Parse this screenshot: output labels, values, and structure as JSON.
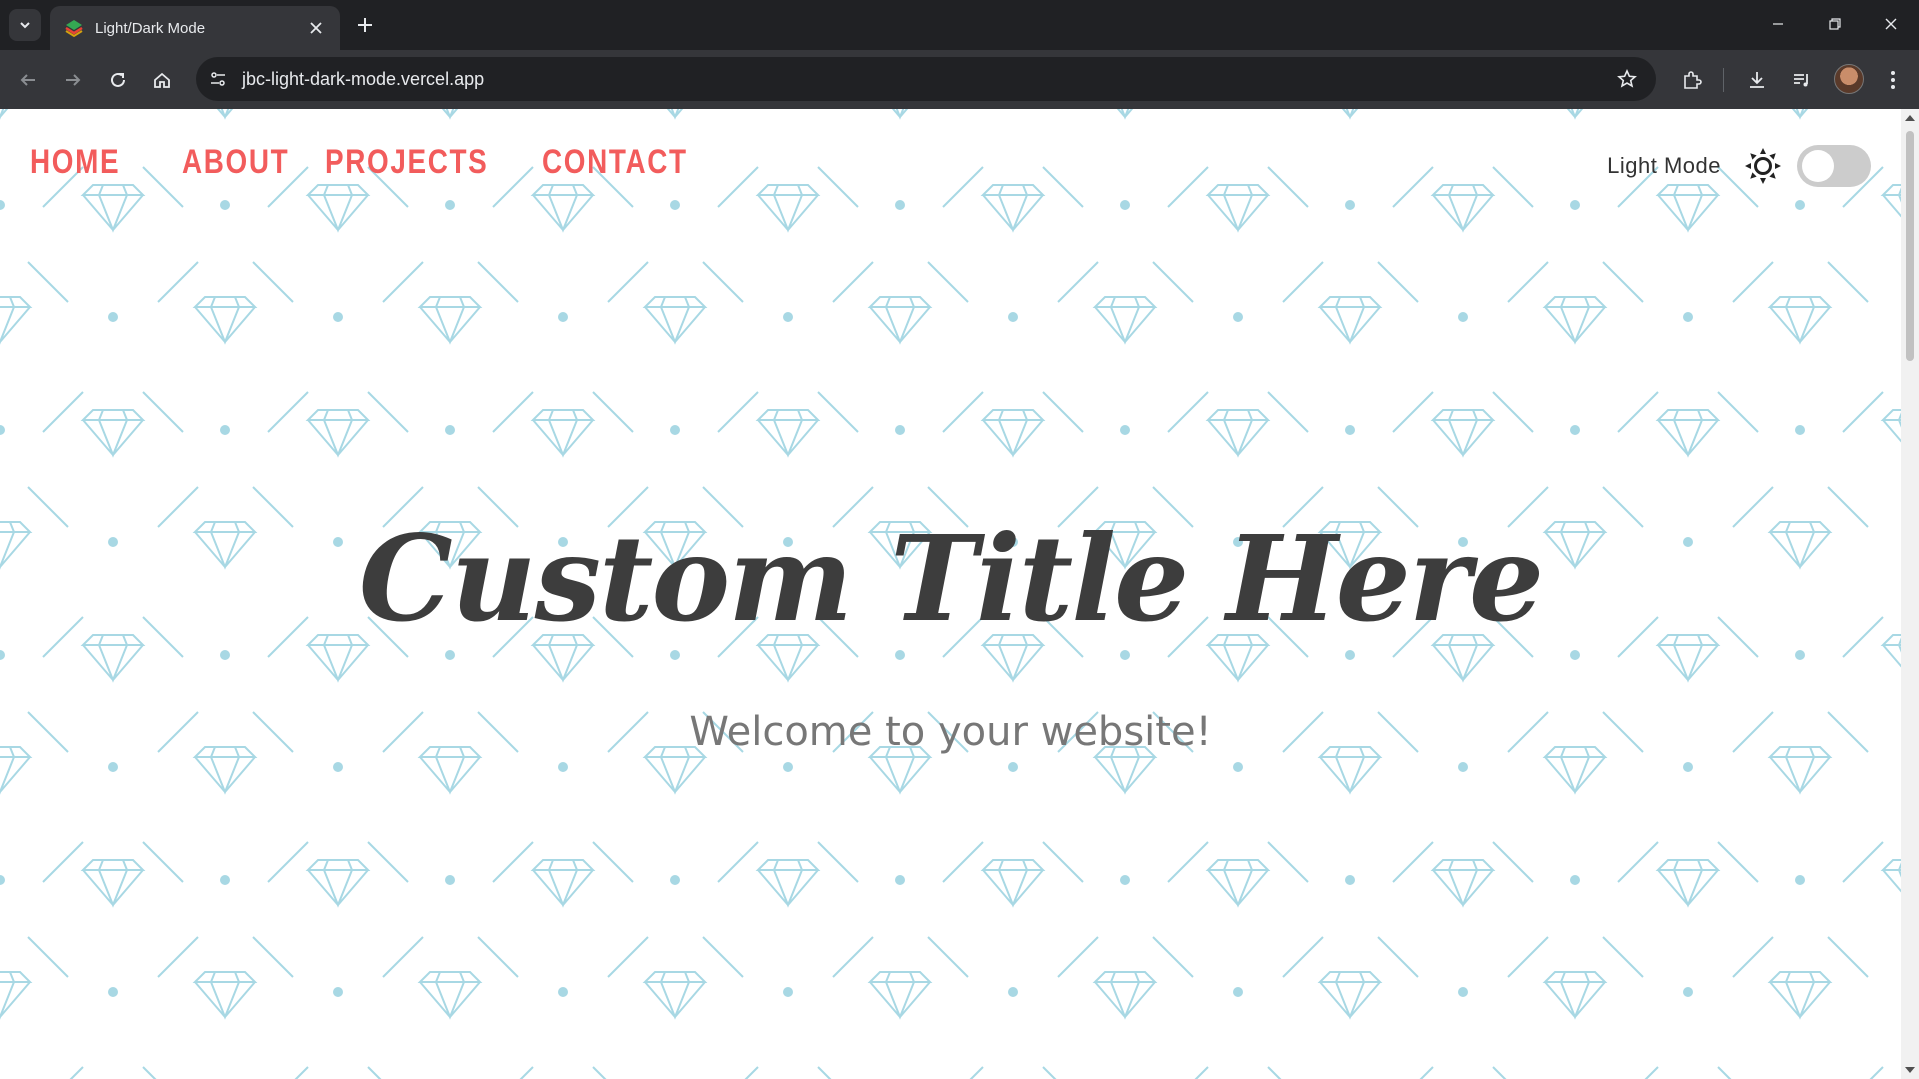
{
  "browser": {
    "tab_title": "Light/Dark Mode",
    "url": "jbc-light-dark-mode.vercel.app"
  },
  "page": {
    "nav": [
      "HOME",
      "ABOUT",
      "PROJECTS",
      "CONTACT"
    ],
    "mode_label": "Light Mode",
    "toggle_on": false,
    "title": "Custom Title Here",
    "subtitle": "Welcome to your website!",
    "colors": {
      "nav": "#f25c5c",
      "title": "#3d3d3d",
      "pattern": "#a8d8e4",
      "background": "#ffffff"
    }
  }
}
